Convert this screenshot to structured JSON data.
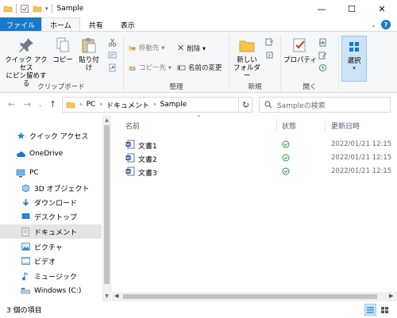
{
  "window": {
    "title": "Sample",
    "controls": {
      "minimize": "—",
      "maximize": "☐",
      "close": "✕"
    }
  },
  "tabs": [
    {
      "label": "ファイル"
    },
    {
      "label": "ホーム"
    },
    {
      "label": "共有"
    },
    {
      "label": "表示"
    }
  ],
  "ribbon": {
    "clipboard": {
      "label": "クリップボード",
      "pin": "クイック アクセス\nにピン留めする",
      "copy": "コピー",
      "paste": "貼り付け"
    },
    "organize": {
      "label": "整理",
      "move_to": "移動先 ▾",
      "copy_to": "コピー先 ▾",
      "delete": "削除 ▾",
      "rename": "名前の変更"
    },
    "new": {
      "label": "新規",
      "new_folder": "新しい\nフォルダー"
    },
    "open": {
      "label": "開く",
      "properties": "プロパティ"
    },
    "select": {
      "label": "選択"
    }
  },
  "address": {
    "breadcrumbs": [
      "PC",
      "ドキュメント",
      "Sample"
    ],
    "search_placeholder": "Sampleの検索"
  },
  "nav_pane": {
    "items": [
      {
        "label": "クイック アクセス",
        "icon": "star-icon"
      },
      {
        "label": "OneDrive",
        "icon": "cloud-icon"
      },
      {
        "label": "PC",
        "icon": "pc-icon"
      },
      {
        "label": "3D オブジェクト",
        "icon": "cube-icon"
      },
      {
        "label": "ダウンロード",
        "icon": "download-icon"
      },
      {
        "label": "デスクトップ",
        "icon": "desktop-icon"
      },
      {
        "label": "ドキュメント",
        "icon": "document-icon",
        "selected": true
      },
      {
        "label": "ピクチャ",
        "icon": "picture-icon"
      },
      {
        "label": "ビデオ",
        "icon": "video-icon"
      },
      {
        "label": "ミュージック",
        "icon": "music-icon"
      },
      {
        "label": "Windows (C:)",
        "icon": "drive-icon"
      }
    ]
  },
  "file_list": {
    "columns": {
      "name": "名前",
      "status": "状態",
      "modified": "更新日時"
    },
    "rows": [
      {
        "name": "文書1",
        "status": "synced",
        "modified": "2022/01/21 12:15"
      },
      {
        "name": "文書2",
        "status": "synced",
        "modified": "2022/01/21 12:15"
      },
      {
        "name": "文書3",
        "status": "synced",
        "modified": "2022/01/21 12:15"
      }
    ]
  },
  "status_bar": {
    "item_count": "3 個の項目"
  },
  "colors": {
    "accent": "#1979ca",
    "selection": "#cce4f7",
    "sync_green": "#2b9a3f",
    "nav_selected": "#e5e5e5"
  }
}
